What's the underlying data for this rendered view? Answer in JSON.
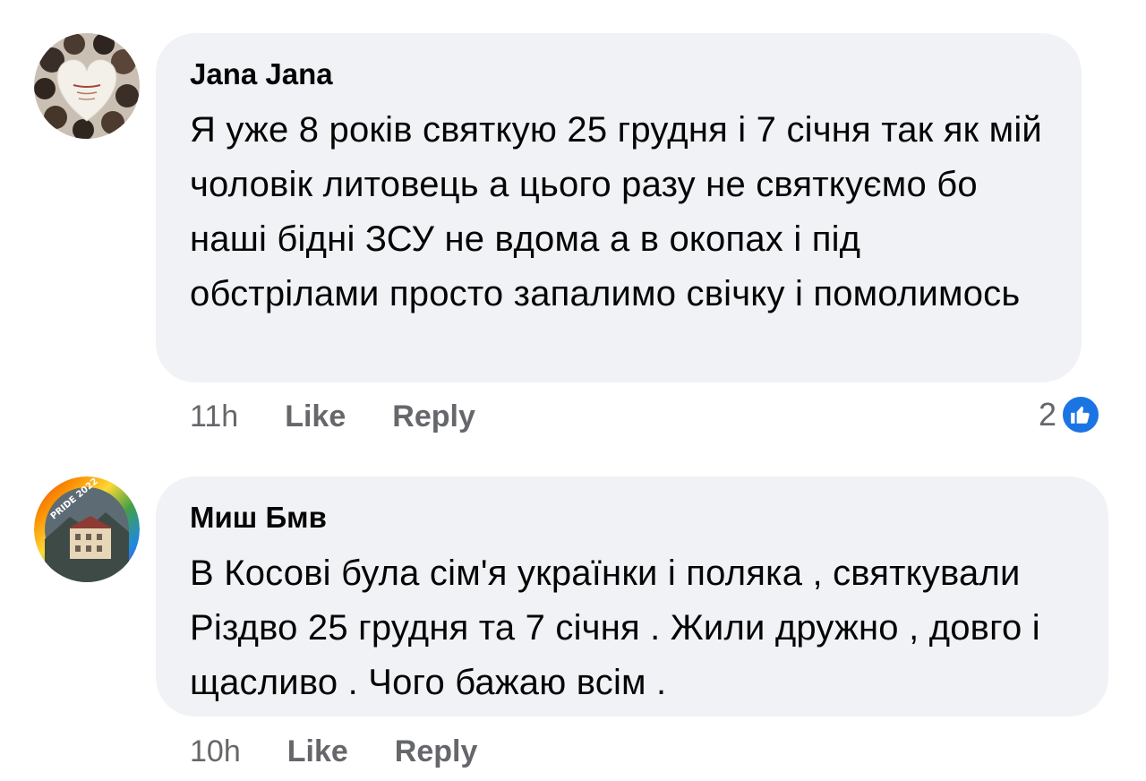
{
  "comments": [
    {
      "author": "Jana Jana",
      "text": "Я уже 8 років святкую 25 грудня і 7 січня так як мій чоловік литовець а цього разу не святкуємо бо наші бідні ЗСУ не вдома а в окопах і під обстрілами просто запалимо свічку і помолимось",
      "time": "11h",
      "like_label": "Like",
      "reply_label": "Reply",
      "reaction_count": "2",
      "reaction_icon": "like-thumb-icon",
      "avatar_icon": "heart-group-photo-avatar"
    },
    {
      "author": "Миш Бмв",
      "text": "В Косові була сім'я українки і поляка , святкували Різдво 25 грудня та 7 січня . Жили дружно , довго і щасливо . Чого бажаю всім .",
      "time": "10h",
      "like_label": "Like",
      "reply_label": "Reply",
      "avatar_badge": "PRIDE 2022",
      "avatar_icon": "rainbow-ring-building-avatar"
    }
  ],
  "colors": {
    "bubble": "#f0f2f5",
    "meta_text": "#65676b",
    "like_blue": "#1b74e4"
  }
}
